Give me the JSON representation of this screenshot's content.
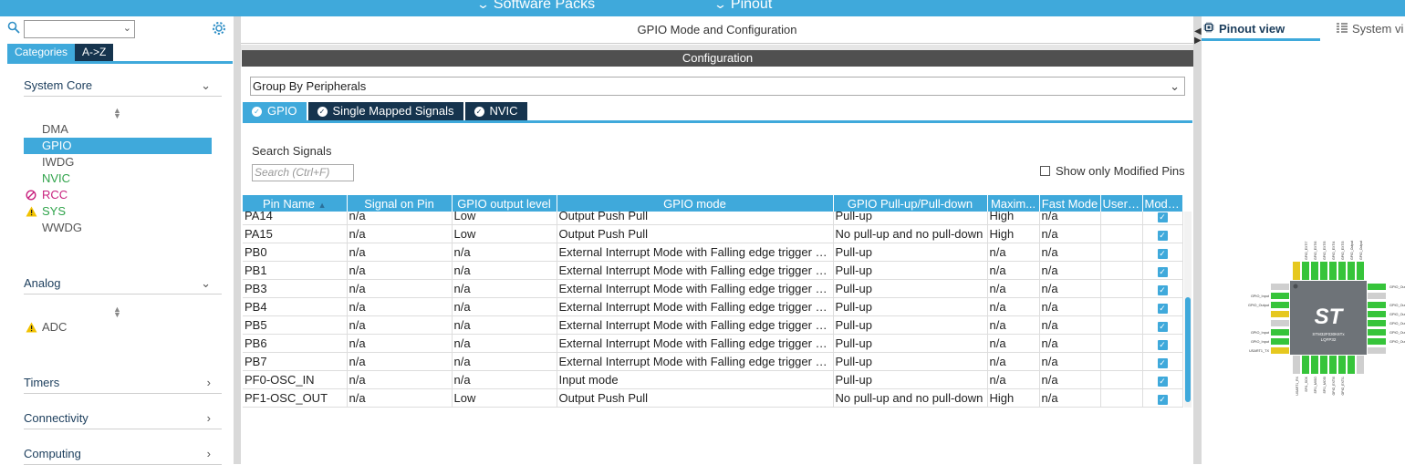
{
  "topbar": {
    "menus": [
      {
        "label": "Software Packs"
      },
      {
        "label": "Pinout"
      }
    ]
  },
  "left": {
    "tabs": [
      {
        "label": "Categories"
      },
      {
        "label": "A->Z"
      }
    ],
    "categories": [
      {
        "label": "System Core",
        "expanded": true
      },
      {
        "label": "Analog",
        "expanded": true
      },
      {
        "label": "Timers",
        "expanded": false
      },
      {
        "label": "Connectivity",
        "expanded": false
      },
      {
        "label": "Computing",
        "expanded": false
      }
    ],
    "system_core_items": [
      {
        "label": "DMA",
        "status": "none"
      },
      {
        "label": "GPIO",
        "status": "selected"
      },
      {
        "label": "IWDG",
        "status": "none"
      },
      {
        "label": "NVIC",
        "status": "enabled"
      },
      {
        "label": "RCC",
        "status": "disabled"
      },
      {
        "label": "SYS",
        "status": "warning"
      },
      {
        "label": "WWDG",
        "status": "none"
      }
    ],
    "analog_items": [
      {
        "label": "ADC",
        "status": "warning"
      }
    ]
  },
  "middle": {
    "title": "GPIO Mode and Configuration",
    "config_label": "Configuration",
    "group_select": "Group By Peripherals",
    "tabs": [
      {
        "label": "GPIO",
        "active": true
      },
      {
        "label": "Single Mapped Signals",
        "active": false
      },
      {
        "label": "NVIC",
        "active": false
      }
    ],
    "search_label": "Search Signals",
    "search_placeholder": "Search (Ctrl+F)",
    "show_modified_label": "Show only Modified Pins",
    "columns": [
      "Pin Name",
      "Signal on Pin",
      "GPIO output level",
      "GPIO mode",
      "GPIO Pull-up/Pull-down",
      "Maxim...",
      "Fast Mode",
      "User ...",
      "Modif..."
    ],
    "rows": [
      {
        "pin": "PA14",
        "signal": "n/a",
        "level": "Low",
        "mode": "Output Push Pull",
        "pull": "Pull-up",
        "speed": "High",
        "fast": "n/a",
        "user": "",
        "modified": true
      },
      {
        "pin": "PA15",
        "signal": "n/a",
        "level": "Low",
        "mode": "Output Push Pull",
        "pull": "No pull-up and no pull-down",
        "speed": "High",
        "fast": "n/a",
        "user": "",
        "modified": true
      },
      {
        "pin": "PB0",
        "signal": "n/a",
        "level": "n/a",
        "mode": "External Interrupt Mode with Falling edge trigger d...",
        "pull": "Pull-up",
        "speed": "n/a",
        "fast": "n/a",
        "user": "",
        "modified": true
      },
      {
        "pin": "PB1",
        "signal": "n/a",
        "level": "n/a",
        "mode": "External Interrupt Mode with Falling edge trigger d...",
        "pull": "Pull-up",
        "speed": "n/a",
        "fast": "n/a",
        "user": "",
        "modified": true
      },
      {
        "pin": "PB3",
        "signal": "n/a",
        "level": "n/a",
        "mode": "External Interrupt Mode with Falling edge trigger d...",
        "pull": "Pull-up",
        "speed": "n/a",
        "fast": "n/a",
        "user": "",
        "modified": true
      },
      {
        "pin": "PB4",
        "signal": "n/a",
        "level": "n/a",
        "mode": "External Interrupt Mode with Falling edge trigger d...",
        "pull": "Pull-up",
        "speed": "n/a",
        "fast": "n/a",
        "user": "",
        "modified": true
      },
      {
        "pin": "PB5",
        "signal": "n/a",
        "level": "n/a",
        "mode": "External Interrupt Mode with Falling edge trigger d...",
        "pull": "Pull-up",
        "speed": "n/a",
        "fast": "n/a",
        "user": "",
        "modified": true
      },
      {
        "pin": "PB6",
        "signal": "n/a",
        "level": "n/a",
        "mode": "External Interrupt Mode with Falling edge trigger d...",
        "pull": "Pull-up",
        "speed": "n/a",
        "fast": "n/a",
        "user": "",
        "modified": true
      },
      {
        "pin": "PB7",
        "signal": "n/a",
        "level": "n/a",
        "mode": "External Interrupt Mode with Falling edge trigger d...",
        "pull": "Pull-up",
        "speed": "n/a",
        "fast": "n/a",
        "user": "",
        "modified": true
      },
      {
        "pin": "PF0-OSC_IN",
        "signal": "n/a",
        "level": "n/a",
        "mode": "Input mode",
        "pull": "Pull-up",
        "speed": "n/a",
        "fast": "n/a",
        "user": "",
        "modified": true
      },
      {
        "pin": "PF1-OSC_OUT",
        "signal": "n/a",
        "level": "Low",
        "mode": "Output Push Pull",
        "pull": "No pull-up and no pull-down",
        "speed": "High",
        "fast": "n/a",
        "user": "",
        "modified": true
      }
    ]
  },
  "right": {
    "tabs": [
      {
        "label": "Pinout view",
        "active": true
      },
      {
        "label": "System vi",
        "active": false
      }
    ],
    "chip": {
      "logo": "ST",
      "part": "STM32F030K6Tx",
      "package": "LQFP32"
    }
  },
  "colors": {
    "accent": "#3fa9db",
    "dark_tab": "#16344e",
    "config_bar": "#505050",
    "enabled": "#2fa34a",
    "disabled": "#c8217e",
    "warning": "#e6b800",
    "pin_green": "#36c43a"
  }
}
